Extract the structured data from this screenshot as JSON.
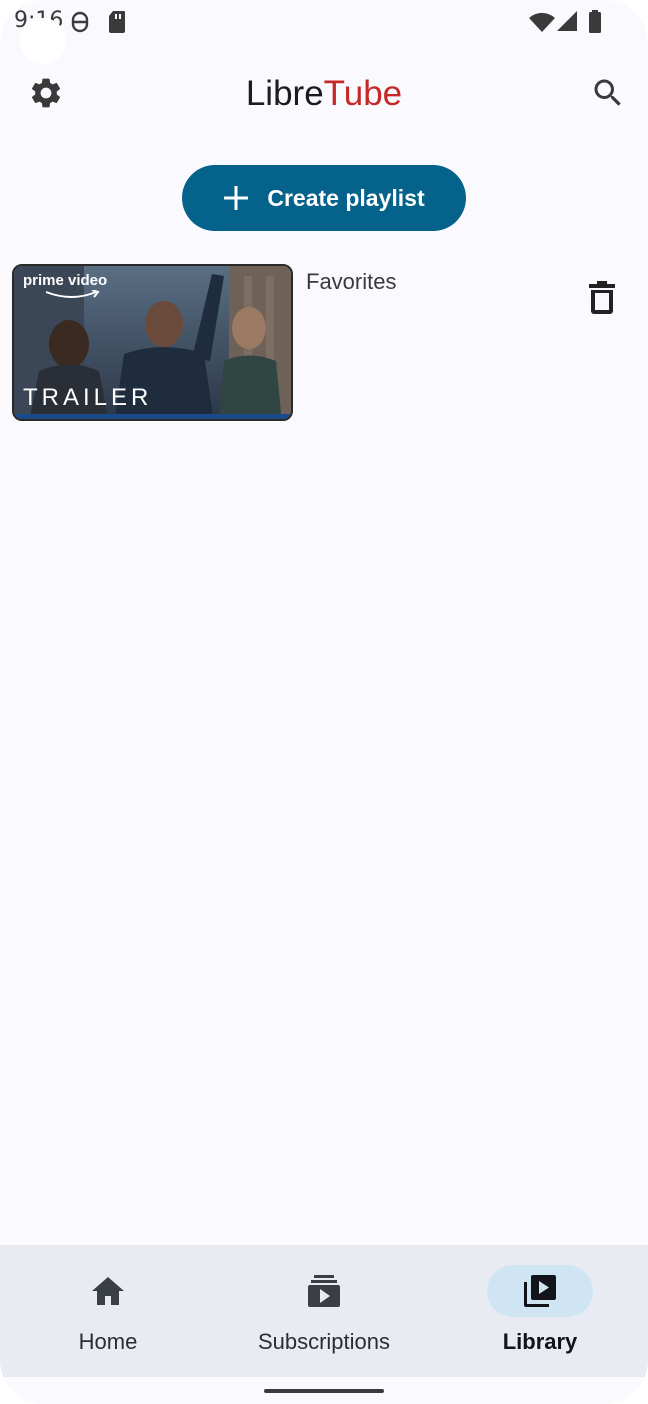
{
  "status_bar": {
    "time": "9:16",
    "icons": [
      "face-icon",
      "sd-card-icon",
      "wifi-icon",
      "signal-icon",
      "battery-icon"
    ]
  },
  "toolbar": {
    "title_part1": "Libre",
    "title_part2": "Tube",
    "left_icon": "settings-icon",
    "right_icon": "search-icon"
  },
  "create_playlist": {
    "label": "Create playlist",
    "icon": "plus-icon"
  },
  "playlists": [
    {
      "name": "Favorites",
      "thumbnail_badge": "prime video",
      "thumbnail_caption": "TRAILER",
      "action_icon": "delete-icon"
    }
  ],
  "bottom_nav": {
    "items": [
      {
        "label": "Home",
        "icon": "home-icon",
        "active": false
      },
      {
        "label": "Subscriptions",
        "icon": "subscriptions-icon",
        "active": false
      },
      {
        "label": "Library",
        "icon": "library-icon",
        "active": true
      }
    ]
  },
  "colors": {
    "accent": "#05628a",
    "title_accent": "#c62828",
    "background": "#faf9fd",
    "nav_background": "#e8ecf2",
    "nav_active_pill": "#cfe5f4"
  }
}
